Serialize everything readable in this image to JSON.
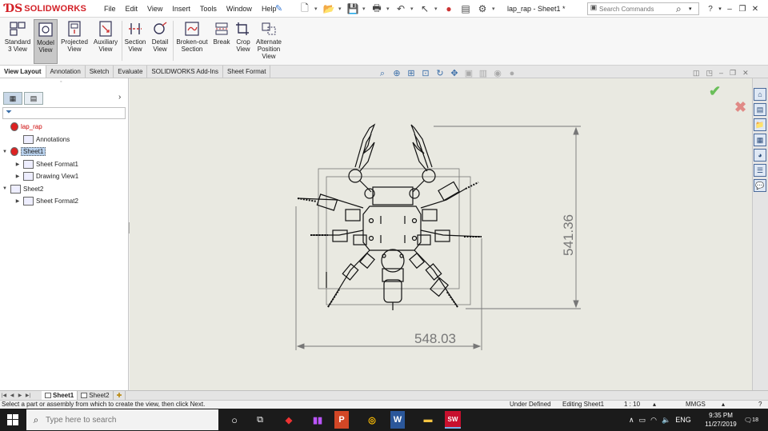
{
  "app": {
    "brand": "SOLIDWORKS",
    "document_title": "lap_rap - Sheet1 *"
  },
  "menu": [
    "File",
    "Edit",
    "View",
    "Insert",
    "Tools",
    "Window",
    "Help"
  ],
  "search": {
    "placeholder": "Search Commands"
  },
  "ribbon": [
    {
      "name": "standard-3-view",
      "label": "Standard 3 View"
    },
    {
      "name": "model-view",
      "label": "Model View",
      "selected": true
    },
    {
      "name": "projected-view",
      "label": "Projected View"
    },
    {
      "name": "auxiliary-view",
      "label": "Auxiliary View"
    },
    {
      "name": "section-view",
      "label": "Section View"
    },
    {
      "name": "detail-view",
      "label": "Detail View"
    },
    {
      "name": "broken-out-section",
      "label": "Broken-out Section"
    },
    {
      "name": "break",
      "label": "Break"
    },
    {
      "name": "crop-view",
      "label": "Crop View"
    },
    {
      "name": "alternate-position-view",
      "label": "Alternate Position View"
    }
  ],
  "tabs": [
    "View Layout",
    "Annotation",
    "Sketch",
    "Evaluate",
    "SOLIDWORKS Add-Ins",
    "Sheet Format"
  ],
  "active_tab": "View Layout",
  "tree": [
    {
      "name": "lap-rap",
      "label": "lap_rap",
      "indent": 0,
      "toggle": "",
      "red": true
    },
    {
      "name": "annotations",
      "label": "Annotations",
      "indent": 1,
      "toggle": ""
    },
    {
      "name": "sheet1",
      "label": "Sheet1",
      "indent": 0,
      "toggle": "▼",
      "selected": true
    },
    {
      "name": "sheet-format1",
      "label": "Sheet Format1",
      "indent": 1,
      "toggle": "▶"
    },
    {
      "name": "drawing-view1",
      "label": "Drawing View1",
      "indent": 1,
      "toggle": "▶"
    },
    {
      "name": "sheet2",
      "label": "Sheet2",
      "indent": 0,
      "toggle": "▼"
    },
    {
      "name": "sheet-format2",
      "label": "Sheet Format2",
      "indent": 1,
      "toggle": "▶"
    }
  ],
  "drawing": {
    "dim_horizontal": "548.03",
    "dim_vertical": "541.36"
  },
  "sheet_tabs": [
    "Sheet1",
    "Sheet2"
  ],
  "status": {
    "message": "Select a part or assembly from which to create the view, then click Next.",
    "definition": "Under Defined",
    "editing": "Editing Sheet1",
    "scale": "1 : 10",
    "units": "MMGS"
  },
  "taskbar": {
    "search_placeholder": "Type here to search",
    "lang": "ENG",
    "time": "9:35 PM",
    "date": "11/27/2019",
    "notifications": "18"
  }
}
